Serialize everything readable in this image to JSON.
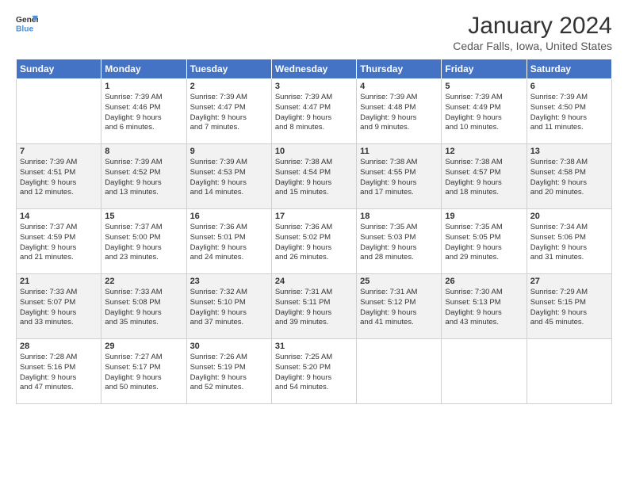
{
  "header": {
    "logo_general": "General",
    "logo_blue": "Blue",
    "month_title": "January 2024",
    "subtitle": "Cedar Falls, Iowa, United States"
  },
  "days_of_week": [
    "Sunday",
    "Monday",
    "Tuesday",
    "Wednesday",
    "Thursday",
    "Friday",
    "Saturday"
  ],
  "weeks": [
    [
      {
        "day": "",
        "content": ""
      },
      {
        "day": "1",
        "content": "Sunrise: 7:39 AM\nSunset: 4:46 PM\nDaylight: 9 hours\nand 6 minutes."
      },
      {
        "day": "2",
        "content": "Sunrise: 7:39 AM\nSunset: 4:47 PM\nDaylight: 9 hours\nand 7 minutes."
      },
      {
        "day": "3",
        "content": "Sunrise: 7:39 AM\nSunset: 4:47 PM\nDaylight: 9 hours\nand 8 minutes."
      },
      {
        "day": "4",
        "content": "Sunrise: 7:39 AM\nSunset: 4:48 PM\nDaylight: 9 hours\nand 9 minutes."
      },
      {
        "day": "5",
        "content": "Sunrise: 7:39 AM\nSunset: 4:49 PM\nDaylight: 9 hours\nand 10 minutes."
      },
      {
        "day": "6",
        "content": "Sunrise: 7:39 AM\nSunset: 4:50 PM\nDaylight: 9 hours\nand 11 minutes."
      }
    ],
    [
      {
        "day": "7",
        "content": "Sunrise: 7:39 AM\nSunset: 4:51 PM\nDaylight: 9 hours\nand 12 minutes."
      },
      {
        "day": "8",
        "content": "Sunrise: 7:39 AM\nSunset: 4:52 PM\nDaylight: 9 hours\nand 13 minutes."
      },
      {
        "day": "9",
        "content": "Sunrise: 7:39 AM\nSunset: 4:53 PM\nDaylight: 9 hours\nand 14 minutes."
      },
      {
        "day": "10",
        "content": "Sunrise: 7:38 AM\nSunset: 4:54 PM\nDaylight: 9 hours\nand 15 minutes."
      },
      {
        "day": "11",
        "content": "Sunrise: 7:38 AM\nSunset: 4:55 PM\nDaylight: 9 hours\nand 17 minutes."
      },
      {
        "day": "12",
        "content": "Sunrise: 7:38 AM\nSunset: 4:57 PM\nDaylight: 9 hours\nand 18 minutes."
      },
      {
        "day": "13",
        "content": "Sunrise: 7:38 AM\nSunset: 4:58 PM\nDaylight: 9 hours\nand 20 minutes."
      }
    ],
    [
      {
        "day": "14",
        "content": "Sunrise: 7:37 AM\nSunset: 4:59 PM\nDaylight: 9 hours\nand 21 minutes."
      },
      {
        "day": "15",
        "content": "Sunrise: 7:37 AM\nSunset: 5:00 PM\nDaylight: 9 hours\nand 23 minutes."
      },
      {
        "day": "16",
        "content": "Sunrise: 7:36 AM\nSunset: 5:01 PM\nDaylight: 9 hours\nand 24 minutes."
      },
      {
        "day": "17",
        "content": "Sunrise: 7:36 AM\nSunset: 5:02 PM\nDaylight: 9 hours\nand 26 minutes."
      },
      {
        "day": "18",
        "content": "Sunrise: 7:35 AM\nSunset: 5:03 PM\nDaylight: 9 hours\nand 28 minutes."
      },
      {
        "day": "19",
        "content": "Sunrise: 7:35 AM\nSunset: 5:05 PM\nDaylight: 9 hours\nand 29 minutes."
      },
      {
        "day": "20",
        "content": "Sunrise: 7:34 AM\nSunset: 5:06 PM\nDaylight: 9 hours\nand 31 minutes."
      }
    ],
    [
      {
        "day": "21",
        "content": "Sunrise: 7:33 AM\nSunset: 5:07 PM\nDaylight: 9 hours\nand 33 minutes."
      },
      {
        "day": "22",
        "content": "Sunrise: 7:33 AM\nSunset: 5:08 PM\nDaylight: 9 hours\nand 35 minutes."
      },
      {
        "day": "23",
        "content": "Sunrise: 7:32 AM\nSunset: 5:10 PM\nDaylight: 9 hours\nand 37 minutes."
      },
      {
        "day": "24",
        "content": "Sunrise: 7:31 AM\nSunset: 5:11 PM\nDaylight: 9 hours\nand 39 minutes."
      },
      {
        "day": "25",
        "content": "Sunrise: 7:31 AM\nSunset: 5:12 PM\nDaylight: 9 hours\nand 41 minutes."
      },
      {
        "day": "26",
        "content": "Sunrise: 7:30 AM\nSunset: 5:13 PM\nDaylight: 9 hours\nand 43 minutes."
      },
      {
        "day": "27",
        "content": "Sunrise: 7:29 AM\nSunset: 5:15 PM\nDaylight: 9 hours\nand 45 minutes."
      }
    ],
    [
      {
        "day": "28",
        "content": "Sunrise: 7:28 AM\nSunset: 5:16 PM\nDaylight: 9 hours\nand 47 minutes."
      },
      {
        "day": "29",
        "content": "Sunrise: 7:27 AM\nSunset: 5:17 PM\nDaylight: 9 hours\nand 50 minutes."
      },
      {
        "day": "30",
        "content": "Sunrise: 7:26 AM\nSunset: 5:19 PM\nDaylight: 9 hours\nand 52 minutes."
      },
      {
        "day": "31",
        "content": "Sunrise: 7:25 AM\nSunset: 5:20 PM\nDaylight: 9 hours\nand 54 minutes."
      },
      {
        "day": "",
        "content": ""
      },
      {
        "day": "",
        "content": ""
      },
      {
        "day": "",
        "content": ""
      }
    ]
  ]
}
